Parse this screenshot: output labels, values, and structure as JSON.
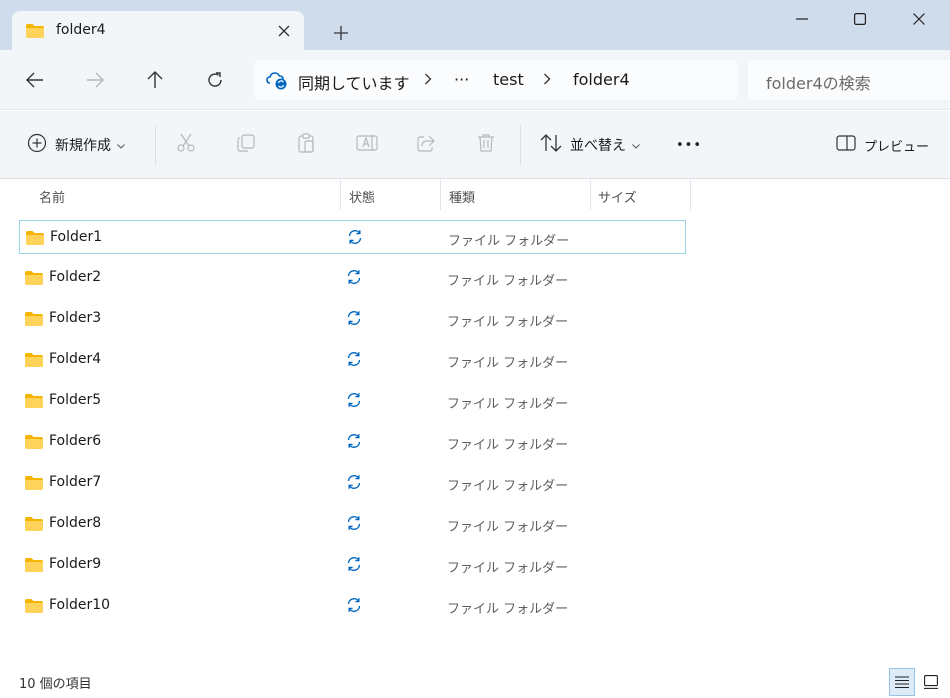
{
  "window": {
    "tab_title": "folder4",
    "tab_icon": "folder-icon",
    "accent": "#0067c0",
    "folder_color": "#ffc83d"
  },
  "address": {
    "root": "同期しています",
    "overflow": "···",
    "crumbs": [
      "test",
      "folder4"
    ]
  },
  "search": {
    "placeholder": "folder4の検索"
  },
  "commands": {
    "new_label": "新規作成",
    "sort_label": "並べ替え",
    "more_label": "•••",
    "preview_label": "プレビュー"
  },
  "columns": {
    "name": "名前",
    "status": "状態",
    "type": "種類",
    "size": "サイズ"
  },
  "files": [
    {
      "name": "Folder1",
      "type": "ファイル フォルダー",
      "status": "sync-icon"
    },
    {
      "name": "Folder2",
      "type": "ファイル フォルダー",
      "status": "sync-icon"
    },
    {
      "name": "Folder3",
      "type": "ファイル フォルダー",
      "status": "sync-icon"
    },
    {
      "name": "Folder4",
      "type": "ファイル フォルダー",
      "status": "sync-icon"
    },
    {
      "name": "Folder5",
      "type": "ファイル フォルダー",
      "status": "sync-icon"
    },
    {
      "name": "Folder6",
      "type": "ファイル フォルダー",
      "status": "sync-icon"
    },
    {
      "name": "Folder7",
      "type": "ファイル フォルダー",
      "status": "sync-icon"
    },
    {
      "name": "Folder8",
      "type": "ファイル フォルダー",
      "status": "sync-icon"
    },
    {
      "name": "Folder9",
      "type": "ファイル フォルダー",
      "status": "sync-icon"
    },
    {
      "name": "Folder10",
      "type": "ファイル フォルダー",
      "status": "sync-icon"
    }
  ],
  "status_bar": {
    "count": "10 個の項目"
  }
}
